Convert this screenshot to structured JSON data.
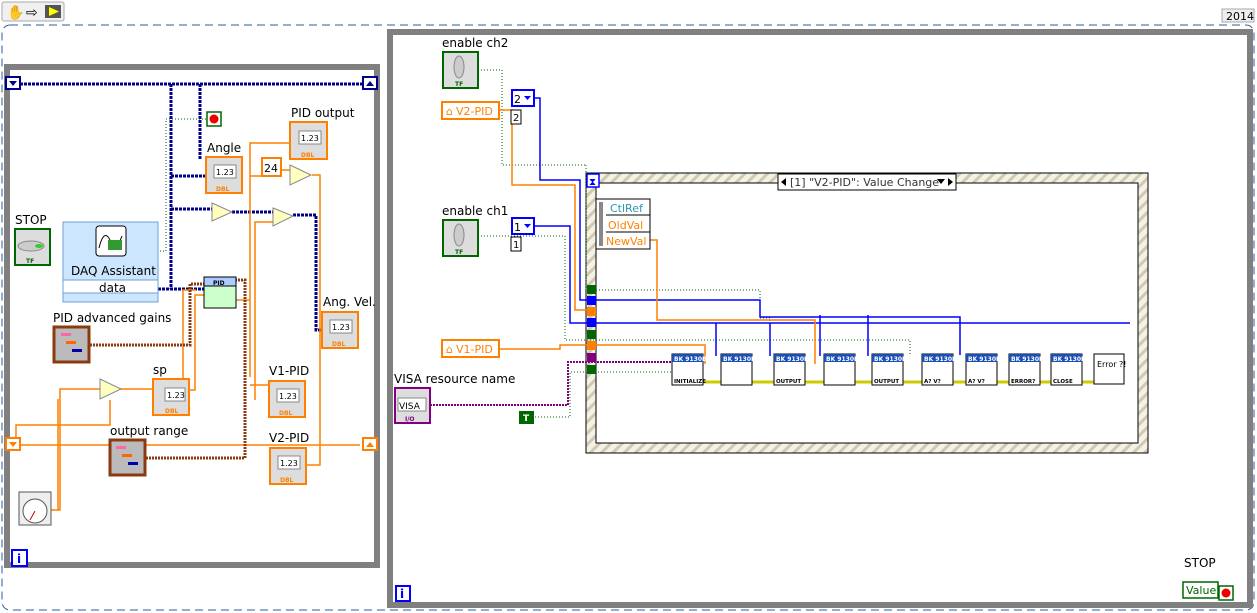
{
  "toolbar": {
    "icons": [
      "hand-icon",
      "arrow-icon",
      "run-icon"
    ],
    "version": "2014"
  },
  "colors": {
    "double": "#ff8000",
    "boolean": "#006600",
    "integer": "#0000ff",
    "cluster": "#8b3a0f",
    "visa": "#800080",
    "error": "#cccc00",
    "loop": "#808080"
  },
  "left_loop": {
    "stop_label": "STOP",
    "daq_label": "DAQ Assistant",
    "daq_output": "data",
    "angle_label": "Angle",
    "pid_output_label": "PID output",
    "const_24": "24",
    "ang_vel_label": "Ang. Vel.",
    "pid_gains_label": "PID advanced gains",
    "sp_label": "sp",
    "v1_label": "V1-PID",
    "output_range_label": "output range",
    "v2_label": "V2-PID",
    "num_display": "1.23",
    "dbl": "DBL",
    "tf": "TF",
    "pid_title": "PID",
    "info": "i"
  },
  "right_loop": {
    "enable_ch2_label": "enable ch2",
    "enable_ch1_label": "enable ch1",
    "v2_local": "V2-PID",
    "v1_local": "V1-PID",
    "ring2": "2",
    "ring2_val": "2",
    "ring1": "1",
    "ring1_val": "1",
    "visa_label": "VISA resource name",
    "visa_text": "VISA",
    "io": "I/O",
    "true_const": "T",
    "event_case": "[1] \"V2-PID\": Value Change",
    "event_data": [
      "CtlRef",
      "OldVal",
      "NewVal"
    ],
    "subvis": [
      {
        "header": "BK 9130B",
        "caption": "INITIALIZE"
      },
      {
        "header": "BK 9130B",
        "caption": ""
      },
      {
        "header": "BK 9130B",
        "caption": "OUTPUT"
      },
      {
        "header": "BK 9130B",
        "caption": ""
      },
      {
        "header": "BK 9130B",
        "caption": "OUTPUT"
      },
      {
        "header": "BK 9130B",
        "caption": "A? V?"
      },
      {
        "header": "BK 9130B",
        "caption": "A? V?"
      },
      {
        "header": "BK 9130B",
        "caption": "ERROR?"
      },
      {
        "header": "BK 9130B",
        "caption": "CLOSE"
      }
    ],
    "error_handler": "Error ?!",
    "stop_label": "STOP",
    "stop_value": "Value",
    "info": "i"
  }
}
